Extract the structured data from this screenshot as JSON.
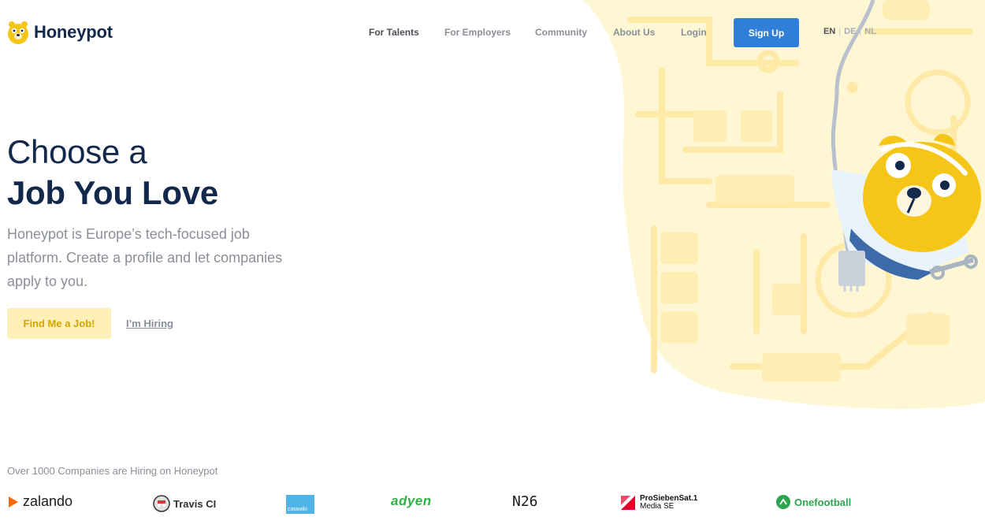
{
  "brand": {
    "name": "Honeypot"
  },
  "nav": {
    "items": [
      {
        "label": "For Talents"
      },
      {
        "label": "For Employers"
      },
      {
        "label": "Community"
      },
      {
        "label": "About Us"
      },
      {
        "label": "Login"
      }
    ],
    "signup_label": "Sign Up",
    "languages": [
      "EN",
      "DE",
      "NL"
    ],
    "active_language": "EN"
  },
  "hero": {
    "headline_line1": "Choose a",
    "headline_line2": "Job You Love",
    "subtext": "Honeypot is Europe’s tech-focused job platform. Create a profile and let companies apply to you.",
    "primary_cta": "Find Me a Job!",
    "secondary_cta": "I’m Hiring"
  },
  "companies": {
    "title": "Over 1000 Companies are Hiring on Honeypot",
    "logos": [
      {
        "name": "zalando",
        "icon": "zalando-logo"
      },
      {
        "name": "Travis CI",
        "icon": "travis-ci-logo"
      },
      {
        "name": "catawiki",
        "icon": "catawiki-logo"
      },
      {
        "name": "adyen",
        "icon": "adyen-logo"
      },
      {
        "name": "N26",
        "icon": "n26-logo"
      },
      {
        "name": "ProSiebenSat.1",
        "sub": "Media SE",
        "icon": "prosiebensat1-logo"
      },
      {
        "name": "Onefootball",
        "icon": "onefootball-logo"
      }
    ]
  },
  "colors": {
    "navy": "#13294b",
    "blue": "#2f7fd8",
    "honey": "#f5c518",
    "pale_yellow": "#fff4cc",
    "gray": "#8a8f98"
  }
}
